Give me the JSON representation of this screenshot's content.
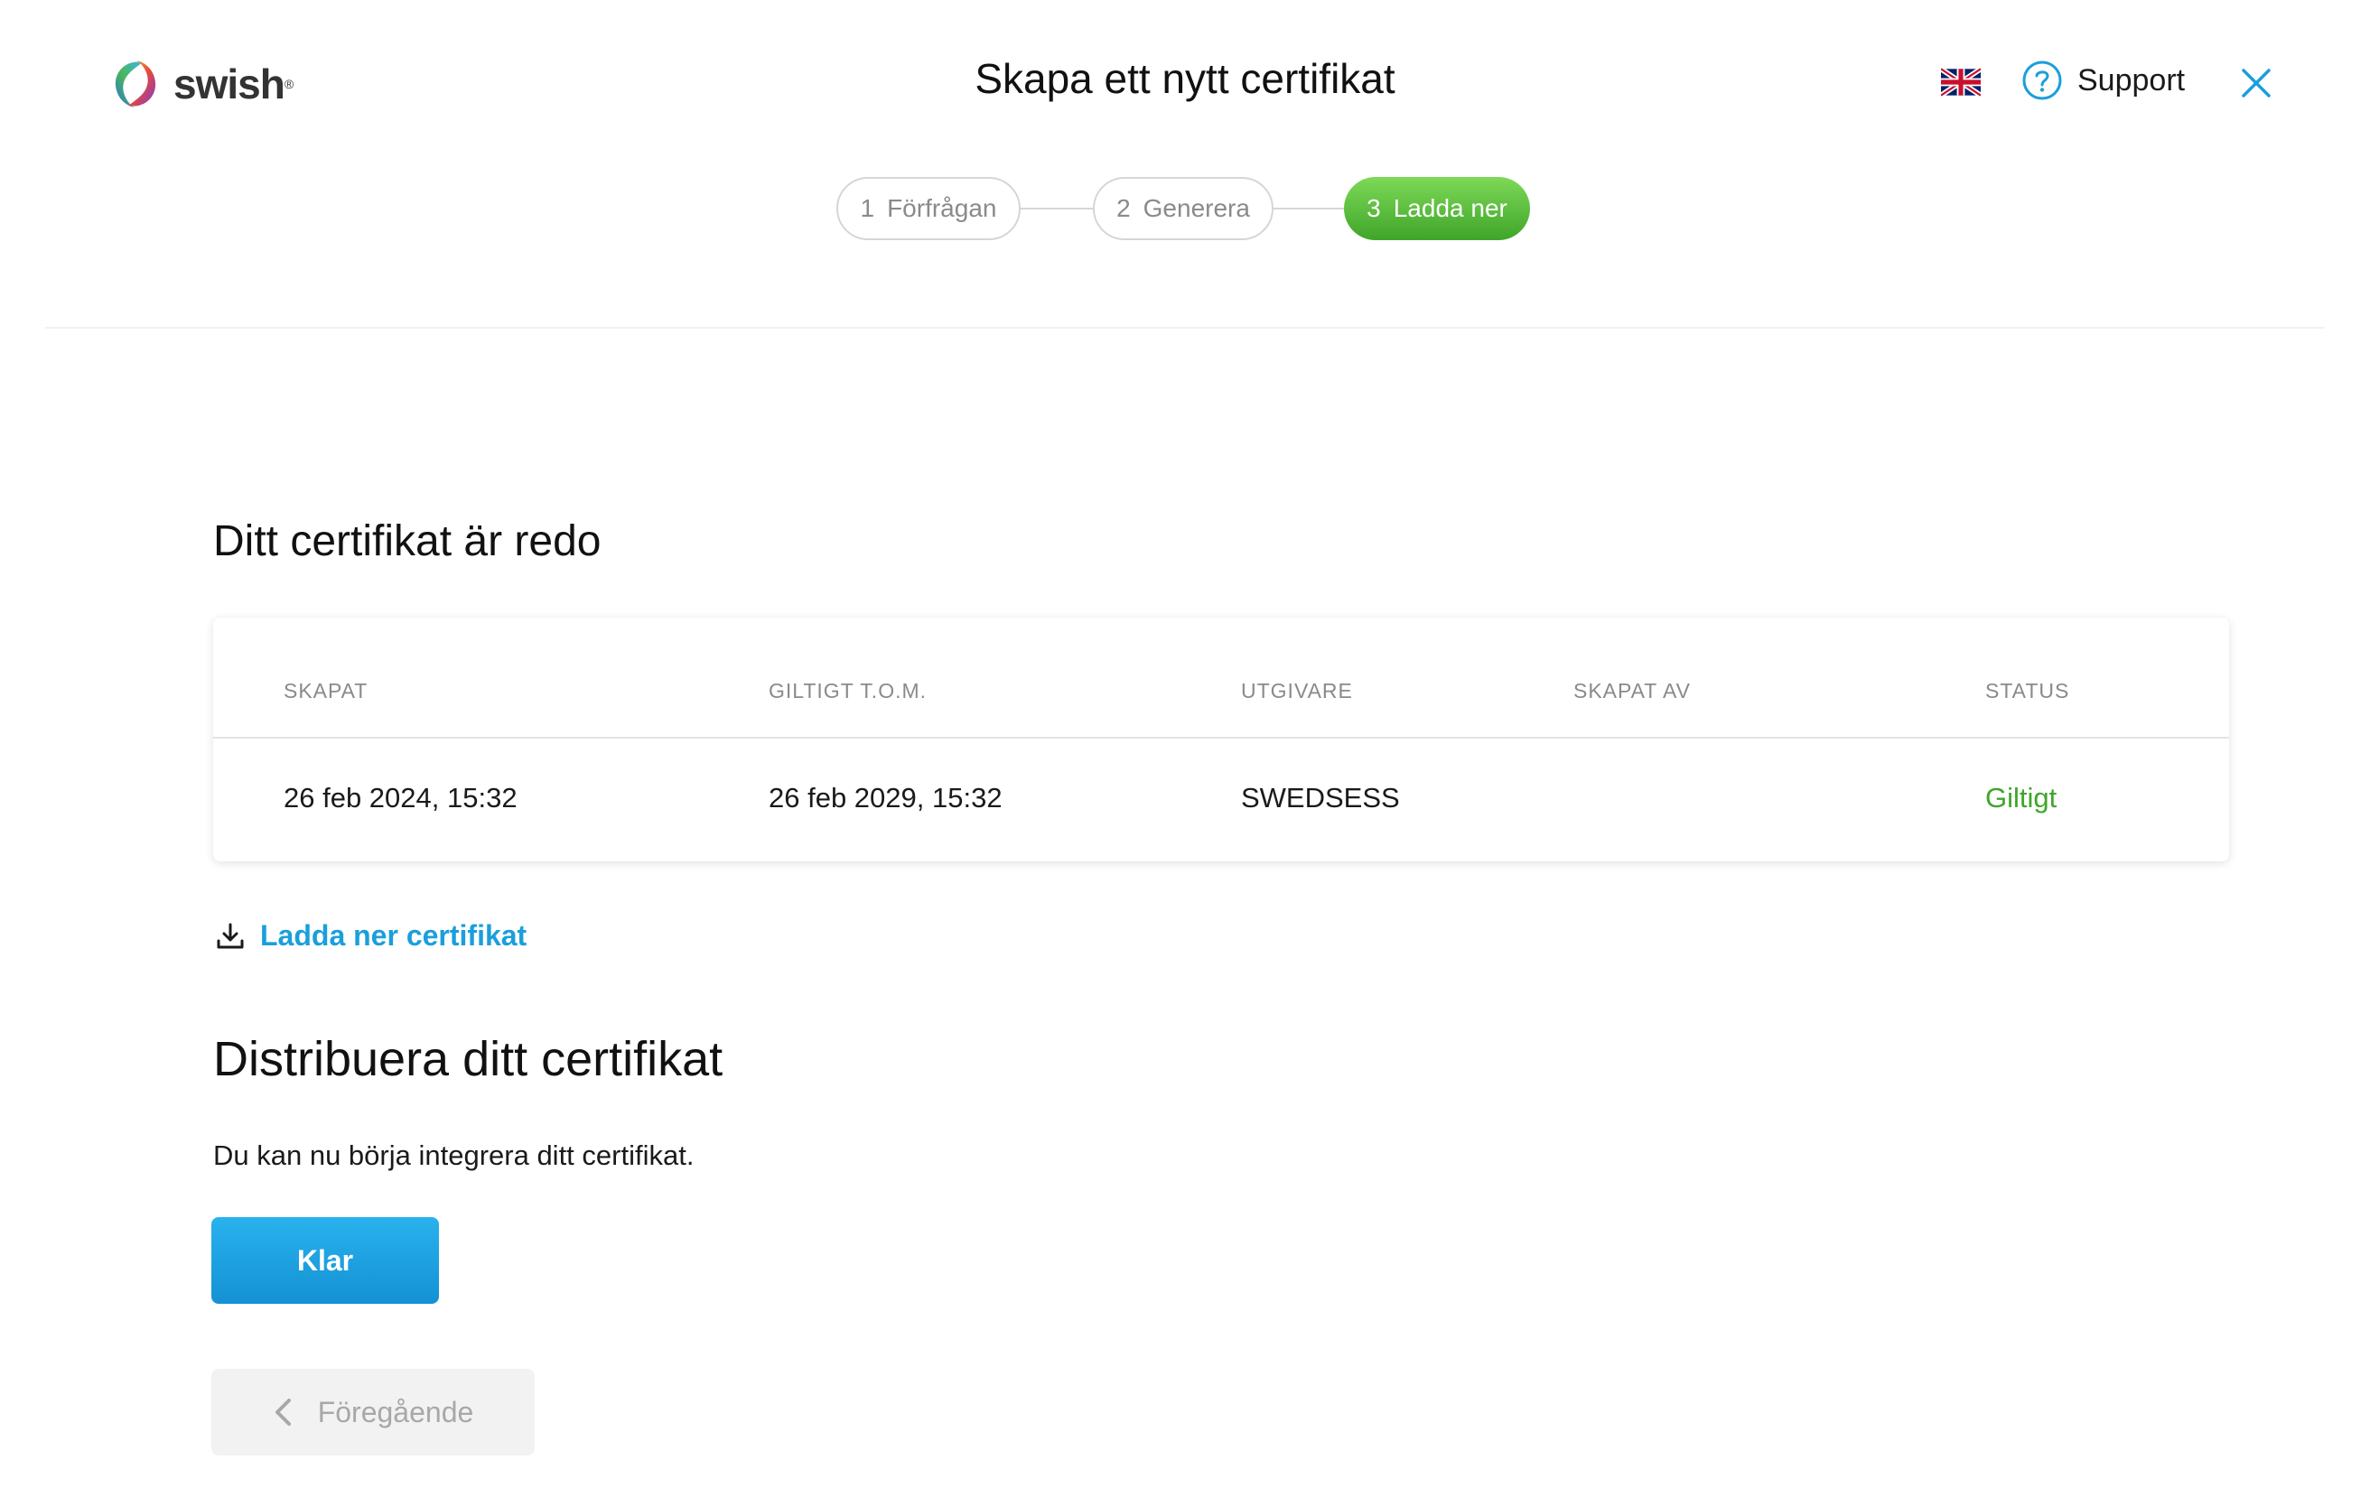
{
  "brand": {
    "name": "swish",
    "reg": "®"
  },
  "header": {
    "title": "Skapa ett nytt certifikat",
    "language_icon": "uk-flag-icon",
    "support_label": "Support",
    "support_icon": "question-circle-icon",
    "close_icon": "close-icon"
  },
  "steps": [
    {
      "num": "1",
      "label": "Förfrågan",
      "state": "done"
    },
    {
      "num": "2",
      "label": "Generera",
      "state": "done"
    },
    {
      "num": "3",
      "label": "Ladda ner",
      "state": "active"
    }
  ],
  "certificate": {
    "heading": "Ditt certifikat är redo",
    "columns": [
      "SKAPAT",
      "GILTIGT T.O.M.",
      "UTGIVARE",
      "SKAPAT AV",
      "STATUS"
    ],
    "row": {
      "created": "26 feb 2024, 15:32",
      "valid_to": "26 feb 2029, 15:32",
      "issuer": "SWEDSESS",
      "created_by": "",
      "status": "Giltigt"
    },
    "download_label": "Ladda ner certifikat",
    "download_icon": "download-icon"
  },
  "distribute": {
    "heading": "Distribuera ditt certifikat",
    "description": "Du kan nu börja integrera ditt certifikat."
  },
  "actions": {
    "done_label": "Klar",
    "previous_label": "Föregående"
  },
  "colors": {
    "accent": "#1a9fdb",
    "success": "#3fa52a",
    "step_active": "#5cbf3a"
  }
}
